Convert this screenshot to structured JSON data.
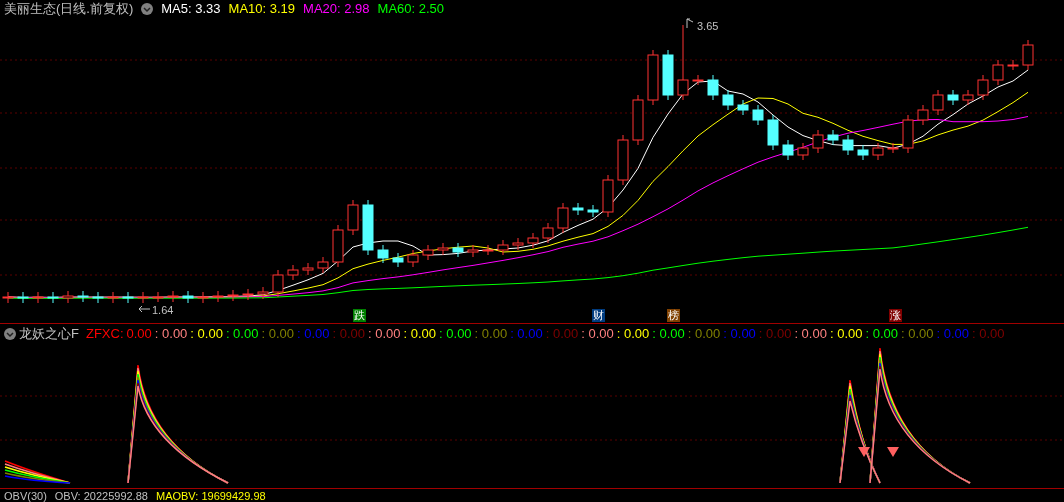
{
  "header": {
    "title": "美丽生态(日线.前复权)",
    "mas": [
      {
        "label": "MA5: 3.33",
        "color": "#ffffff"
      },
      {
        "label": "MA10: 3.19",
        "color": "#ffff00"
      },
      {
        "label": "MA20: 2.98",
        "color": "#ff00ff"
      },
      {
        "label": "MA60: 2.50",
        "color": "#00ff00"
      }
    ]
  },
  "price_chart": {
    "high_label": "3.65",
    "low_label": "1.64",
    "events": [
      {
        "label": "跌",
        "color": "#008000"
      },
      {
        "label": "财",
        "color": "#003c80"
      },
      {
        "label": "榜",
        "color": "#804000"
      },
      {
        "label": "涨",
        "color": "#800000"
      }
    ]
  },
  "indicator": {
    "name": "龙妖之心F",
    "series_label": "ZFXC:",
    "values": [
      {
        "text": "0.00",
        "color": "#ff0000"
      },
      {
        "text": ": 0.00",
        "color": "#ff8080"
      },
      {
        "text": ": 0.00",
        "color": "#ffff00"
      },
      {
        "text": ": 0.00",
        "color": "#00ff00"
      },
      {
        "text": ": 0.00",
        "color": "#808000"
      },
      {
        "text": ": 0.00",
        "color": "#0000ff"
      },
      {
        "text": ": 0.00",
        "color": "#800000"
      },
      {
        "text": ": 0.00",
        "color": "#ff8080"
      },
      {
        "text": ": 0.00",
        "color": "#ffff00"
      },
      {
        "text": ": 0.00",
        "color": "#00ff00"
      },
      {
        "text": ": 0.00",
        "color": "#808000"
      },
      {
        "text": ": 0.00",
        "color": "#0000ff"
      },
      {
        "text": ": 0.00",
        "color": "#800000"
      },
      {
        "text": ": 0.00",
        "color": "#ff8080"
      },
      {
        "text": ": 0.00",
        "color": "#ffff00"
      },
      {
        "text": ": 0.00",
        "color": "#00ff00"
      },
      {
        "text": ": 0.00",
        "color": "#808000"
      },
      {
        "text": ": 0.00",
        "color": "#0000ff"
      },
      {
        "text": ": 0.00",
        "color": "#800000"
      },
      {
        "text": ": 0.00",
        "color": "#ff8080"
      },
      {
        "text": ": 0.00",
        "color": "#ffff00"
      },
      {
        "text": ": 0.00",
        "color": "#00ff00"
      },
      {
        "text": ": 0.00",
        "color": "#808000"
      },
      {
        "text": ": 0.00",
        "color": "#0000ff"
      },
      {
        "text": ": 0.00",
        "color": "#800000"
      }
    ]
  },
  "footer": {
    "name": "OBV(30)",
    "items": [
      {
        "text": "OBV: 20225992.88",
        "color": "#c0c0c0"
      },
      {
        "text": "MAOBV: 19699429.98",
        "color": "#ffff00"
      }
    ]
  }
}
